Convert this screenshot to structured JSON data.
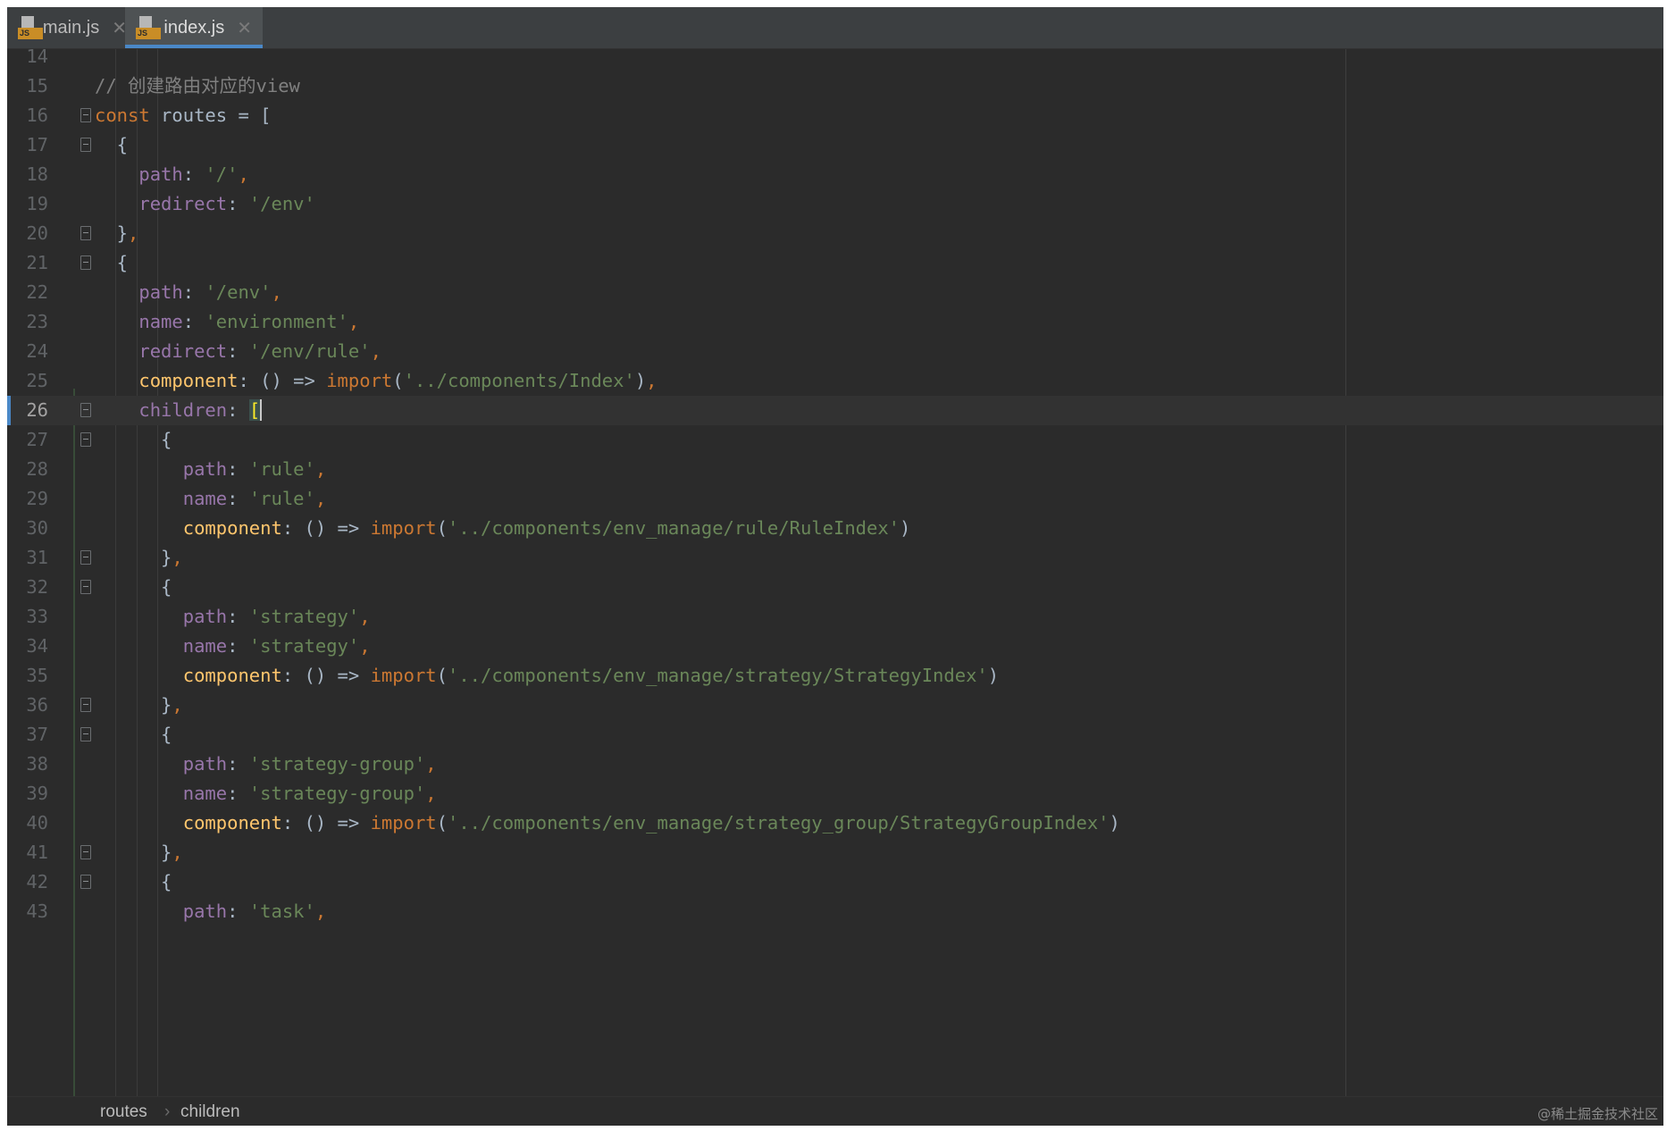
{
  "tabs": [
    {
      "label": "main.js",
      "icon": "js-file-icon",
      "active": false
    },
    {
      "label": "index.js",
      "icon": "js-file-icon",
      "active": true
    }
  ],
  "editor": {
    "current_line": "26",
    "lines": [
      {
        "n": "14",
        "tokens": []
      },
      {
        "n": "15",
        "tokens": [
          {
            "t": "// 创建路由对应的view",
            "c": "cmt"
          }
        ]
      },
      {
        "n": "16",
        "tokens": [
          {
            "t": "const",
            "c": "kw"
          },
          {
            "t": " routes = [",
            "c": "punc"
          }
        ]
      },
      {
        "n": "17",
        "tokens": [
          {
            "t": "  {",
            "c": "punc"
          }
        ]
      },
      {
        "n": "18",
        "tokens": [
          {
            "t": "    ",
            "c": "punc"
          },
          {
            "t": "path",
            "c": "prop"
          },
          {
            "t": ": ",
            "c": "punc"
          },
          {
            "t": "'/'",
            "c": "str"
          },
          {
            "t": ",",
            "c": "kw"
          }
        ]
      },
      {
        "n": "19",
        "tokens": [
          {
            "t": "    ",
            "c": "punc"
          },
          {
            "t": "redirect",
            "c": "prop"
          },
          {
            "t": ": ",
            "c": "punc"
          },
          {
            "t": "'/env'",
            "c": "str"
          }
        ]
      },
      {
        "n": "20",
        "tokens": [
          {
            "t": "  }",
            "c": "punc"
          },
          {
            "t": ",",
            "c": "kw"
          }
        ]
      },
      {
        "n": "21",
        "tokens": [
          {
            "t": "  {",
            "c": "punc"
          }
        ]
      },
      {
        "n": "22",
        "tokens": [
          {
            "t": "    ",
            "c": "punc"
          },
          {
            "t": "path",
            "c": "prop"
          },
          {
            "t": ": ",
            "c": "punc"
          },
          {
            "t": "'/env'",
            "c": "str"
          },
          {
            "t": ",",
            "c": "kw"
          }
        ]
      },
      {
        "n": "23",
        "tokens": [
          {
            "t": "    ",
            "c": "punc"
          },
          {
            "t": "name",
            "c": "prop"
          },
          {
            "t": ": ",
            "c": "punc"
          },
          {
            "t": "'environment'",
            "c": "str"
          },
          {
            "t": ",",
            "c": "kw"
          }
        ]
      },
      {
        "n": "24",
        "tokens": [
          {
            "t": "    ",
            "c": "punc"
          },
          {
            "t": "redirect",
            "c": "prop"
          },
          {
            "t": ": ",
            "c": "punc"
          },
          {
            "t": "'/env/rule'",
            "c": "str"
          },
          {
            "t": ",",
            "c": "kw"
          }
        ]
      },
      {
        "n": "25",
        "tokens": [
          {
            "t": "    ",
            "c": "punc"
          },
          {
            "t": "component",
            "c": "fn"
          },
          {
            "t": ": () => ",
            "c": "punc"
          },
          {
            "t": "import",
            "c": "kw"
          },
          {
            "t": "(",
            "c": "punc"
          },
          {
            "t": "'../components/Index'",
            "c": "str"
          },
          {
            "t": ")",
            "c": "punc"
          },
          {
            "t": ",",
            "c": "kw"
          }
        ]
      },
      {
        "n": "26",
        "tokens": [
          {
            "t": "    ",
            "c": "punc"
          },
          {
            "t": "children",
            "c": "prop"
          },
          {
            "t": ": ",
            "c": "punc"
          },
          {
            "t": "[",
            "c": "bracket-hl"
          }
        ]
      },
      {
        "n": "27",
        "tokens": [
          {
            "t": "      {",
            "c": "punc"
          }
        ]
      },
      {
        "n": "28",
        "tokens": [
          {
            "t": "        ",
            "c": "punc"
          },
          {
            "t": "path",
            "c": "prop"
          },
          {
            "t": ": ",
            "c": "punc"
          },
          {
            "t": "'rule'",
            "c": "str"
          },
          {
            "t": ",",
            "c": "kw"
          }
        ]
      },
      {
        "n": "29",
        "tokens": [
          {
            "t": "        ",
            "c": "punc"
          },
          {
            "t": "name",
            "c": "prop"
          },
          {
            "t": ": ",
            "c": "punc"
          },
          {
            "t": "'rule'",
            "c": "str"
          },
          {
            "t": ",",
            "c": "kw"
          }
        ]
      },
      {
        "n": "30",
        "tokens": [
          {
            "t": "        ",
            "c": "punc"
          },
          {
            "t": "component",
            "c": "fn"
          },
          {
            "t": ": () => ",
            "c": "punc"
          },
          {
            "t": "import",
            "c": "kw"
          },
          {
            "t": "(",
            "c": "punc"
          },
          {
            "t": "'../components/env_manage/rule/RuleIndex'",
            "c": "str"
          },
          {
            "t": ")",
            "c": "punc"
          }
        ]
      },
      {
        "n": "31",
        "tokens": [
          {
            "t": "      }",
            "c": "punc"
          },
          {
            "t": ",",
            "c": "kw"
          }
        ]
      },
      {
        "n": "32",
        "tokens": [
          {
            "t": "      {",
            "c": "punc"
          }
        ]
      },
      {
        "n": "33",
        "tokens": [
          {
            "t": "        ",
            "c": "punc"
          },
          {
            "t": "path",
            "c": "prop"
          },
          {
            "t": ": ",
            "c": "punc"
          },
          {
            "t": "'strategy'",
            "c": "str"
          },
          {
            "t": ",",
            "c": "kw"
          }
        ]
      },
      {
        "n": "34",
        "tokens": [
          {
            "t": "        ",
            "c": "punc"
          },
          {
            "t": "name",
            "c": "prop"
          },
          {
            "t": ": ",
            "c": "punc"
          },
          {
            "t": "'strategy'",
            "c": "str"
          },
          {
            "t": ",",
            "c": "kw"
          }
        ]
      },
      {
        "n": "35",
        "tokens": [
          {
            "t": "        ",
            "c": "punc"
          },
          {
            "t": "component",
            "c": "fn"
          },
          {
            "t": ": () => ",
            "c": "punc"
          },
          {
            "t": "import",
            "c": "kw"
          },
          {
            "t": "(",
            "c": "punc"
          },
          {
            "t": "'../components/env_manage/strategy/StrategyIndex'",
            "c": "str"
          },
          {
            "t": ")",
            "c": "punc"
          }
        ]
      },
      {
        "n": "36",
        "tokens": [
          {
            "t": "      }",
            "c": "punc"
          },
          {
            "t": ",",
            "c": "kw"
          }
        ]
      },
      {
        "n": "37",
        "tokens": [
          {
            "t": "      {",
            "c": "punc"
          }
        ]
      },
      {
        "n": "38",
        "tokens": [
          {
            "t": "        ",
            "c": "punc"
          },
          {
            "t": "path",
            "c": "prop"
          },
          {
            "t": ": ",
            "c": "punc"
          },
          {
            "t": "'strategy-group'",
            "c": "str"
          },
          {
            "t": ",",
            "c": "kw"
          }
        ]
      },
      {
        "n": "39",
        "tokens": [
          {
            "t": "        ",
            "c": "punc"
          },
          {
            "t": "name",
            "c": "prop"
          },
          {
            "t": ": ",
            "c": "punc"
          },
          {
            "t": "'strategy-group'",
            "c": "str"
          },
          {
            "t": ",",
            "c": "kw"
          }
        ]
      },
      {
        "n": "40",
        "tokens": [
          {
            "t": "        ",
            "c": "punc"
          },
          {
            "t": "component",
            "c": "fn"
          },
          {
            "t": ": () => ",
            "c": "punc"
          },
          {
            "t": "import",
            "c": "kw"
          },
          {
            "t": "(",
            "c": "punc"
          },
          {
            "t": "'../components/env_manage/strategy_group/StrategyGroupIndex'",
            "c": "str"
          },
          {
            "t": ")",
            "c": "punc"
          }
        ]
      },
      {
        "n": "41",
        "tokens": [
          {
            "t": "      }",
            "c": "punc"
          },
          {
            "t": ",",
            "c": "kw"
          }
        ]
      },
      {
        "n": "42",
        "tokens": [
          {
            "t": "      {",
            "c": "punc"
          }
        ]
      },
      {
        "n": "43",
        "tokens": [
          {
            "t": "        ",
            "c": "punc"
          },
          {
            "t": "path",
            "c": "prop"
          },
          {
            "t": ": ",
            "c": "punc"
          },
          {
            "t": "'task'",
            "c": "str"
          },
          {
            "t": ",",
            "c": "kw"
          }
        ]
      }
    ],
    "fold_markers": [
      "16",
      "17",
      "20",
      "21",
      "26",
      "27",
      "31",
      "32",
      "36",
      "37",
      "41",
      "42"
    ]
  },
  "breadcrumb": {
    "items": [
      "routes",
      "children"
    ],
    "separator": "›"
  },
  "watermark": "@稀土掘金技术社区",
  "colors": {
    "background": "#2b2b2b",
    "keyword": "#cc7832",
    "property": "#9876aa",
    "string": "#6a8759",
    "comment": "#808080",
    "function": "#ffc66d",
    "accent": "#4a88c7"
  }
}
